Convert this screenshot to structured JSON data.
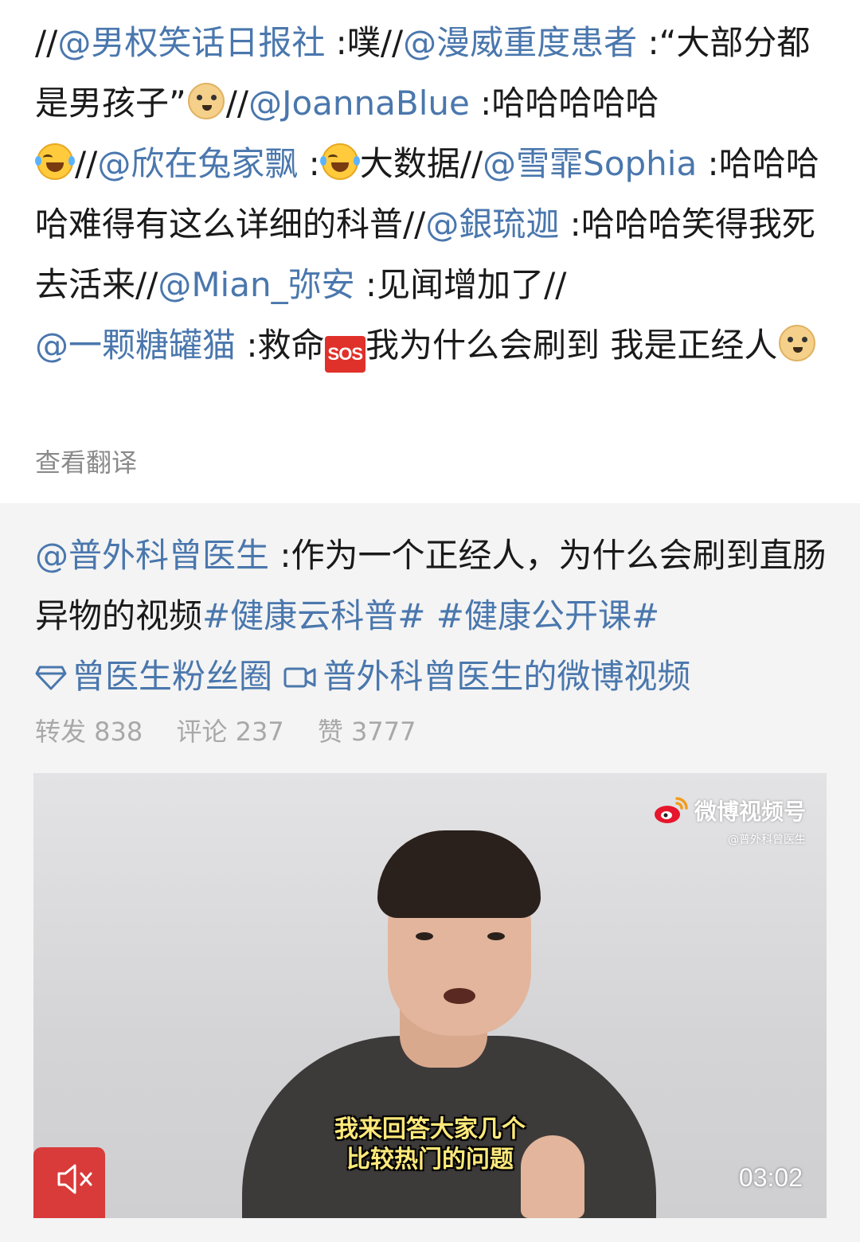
{
  "comment": {
    "parts": {
      "p1": "//",
      "m1": "@男权笑话日报社",
      "t1": " :噗//",
      "m2": "@漫威重度患者",
      "t2": " :“大部分都是男孩子”",
      "e1": "doge",
      "t3": "//",
      "m3": "@JoannaBlue",
      "t4": " :哈哈哈哈哈",
      "e2": "laugh-cry",
      "t5": "//",
      "m4": "@欣在兔家飘",
      "t6": " :",
      "e3": "laugh-cry",
      "t7": "大数据//",
      "m5": "@雪霏Sophia",
      "t8": " :哈哈哈哈难得有这么详细的科普//",
      "m6": "@銀琉迦",
      "t9": " :哈哈哈笑得我死去活来//",
      "m7": "@Mian_弥安",
      "t10": " :见闻增加了//",
      "m8": "@一颗糖罐猫",
      "t11": " :救命",
      "sos": "SOS",
      "t12": "我为什么会刷到 我是正经人",
      "e4": "doge"
    },
    "translate_label": "查看翻译"
  },
  "repost": {
    "author": "@普外科曾医生",
    "text": " :作为一个正经人，为什么会刷到直肠异物的视频",
    "hashtag1": "#健康云科普#",
    "hashtag2": "#健康公开课#",
    "fan_circle": "曾医生粉丝圈",
    "video_link": "普外科曾医生的微博视频",
    "stats": {
      "forward": "转发 838",
      "comment": "评论 237",
      "like": "赞 3777"
    },
    "video": {
      "watermark_title": "微博视频号",
      "watermark_sub": "@普外科曾医生",
      "subtitle_line1": "我来回答大家几个",
      "subtitle_line2": "比较热门的问题",
      "duration": "03:02"
    }
  },
  "colors": {
    "link": "#4a77ad",
    "text": "#1a1a1a",
    "muted": "#8a8a8a",
    "repost_bg": "#f4f4f4",
    "subtitle": "#ffe97a"
  }
}
